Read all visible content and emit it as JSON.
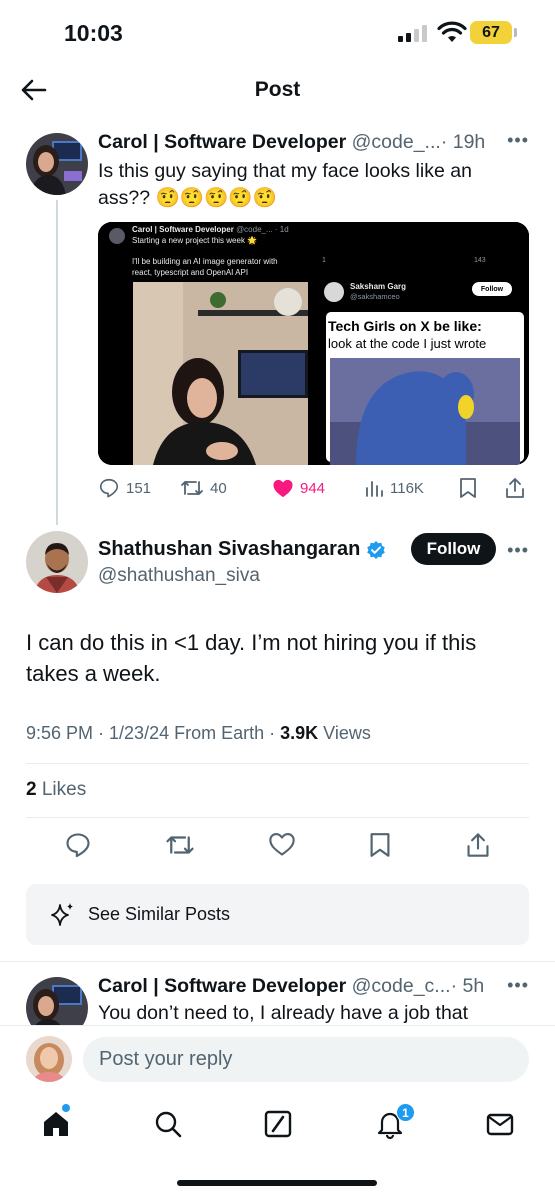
{
  "status_bar": {
    "time": "10:03",
    "battery": "67"
  },
  "header": {
    "title": "Post"
  },
  "quoted_post": {
    "name": "Carol | Software Developer",
    "handle": "@code_...",
    "age": "· 19h",
    "text": "Is this guy saying that my face looks like an ass?? 🤨🤨🤨🤨🤨",
    "media_left": {
      "name": "Carol | Software Developer",
      "handle": "@code_... · 1d",
      "line1": "Starting a new project this week 🌟",
      "line2": "I'll be building an AI image generator with react, typescript and OpenAI API"
    },
    "media_right": {
      "name": "Saksham Garg",
      "handle": "@sakshamceo",
      "follow": "Follow",
      "views": "143",
      "replies": "1",
      "meme_title": "Tech Girls on X be like:",
      "meme_caption": "look at the code I just wrote"
    },
    "stats": {
      "replies": "151",
      "reposts": "40",
      "likes": "944",
      "views": "116K"
    }
  },
  "main_post": {
    "name": "Shathushan Sivashangaran",
    "handle": "@shathushan_siva",
    "follow_label": "Follow",
    "text": "I can do this in <1 day. I’m not hiring you if this takes a week.",
    "timestamp": "9:56 PM · 1/23/24 From Earth · ",
    "views_count": "3.9K",
    "views_label": " Views",
    "likes_count": "2",
    "likes_label": " Likes",
    "similar_label": "See Similar Posts"
  },
  "reply": {
    "name": "Carol | Software Developer",
    "handle": "@code_c...",
    "age": "· 5h",
    "text": "You don’t need to, I already have a job that"
  },
  "composer": {
    "placeholder": "Post your reply"
  },
  "nav": {
    "notifications_count": "1"
  },
  "colors": {
    "like_pink": "#f91880",
    "verified_blue": "#1d9bf0",
    "muted": "#536471"
  }
}
